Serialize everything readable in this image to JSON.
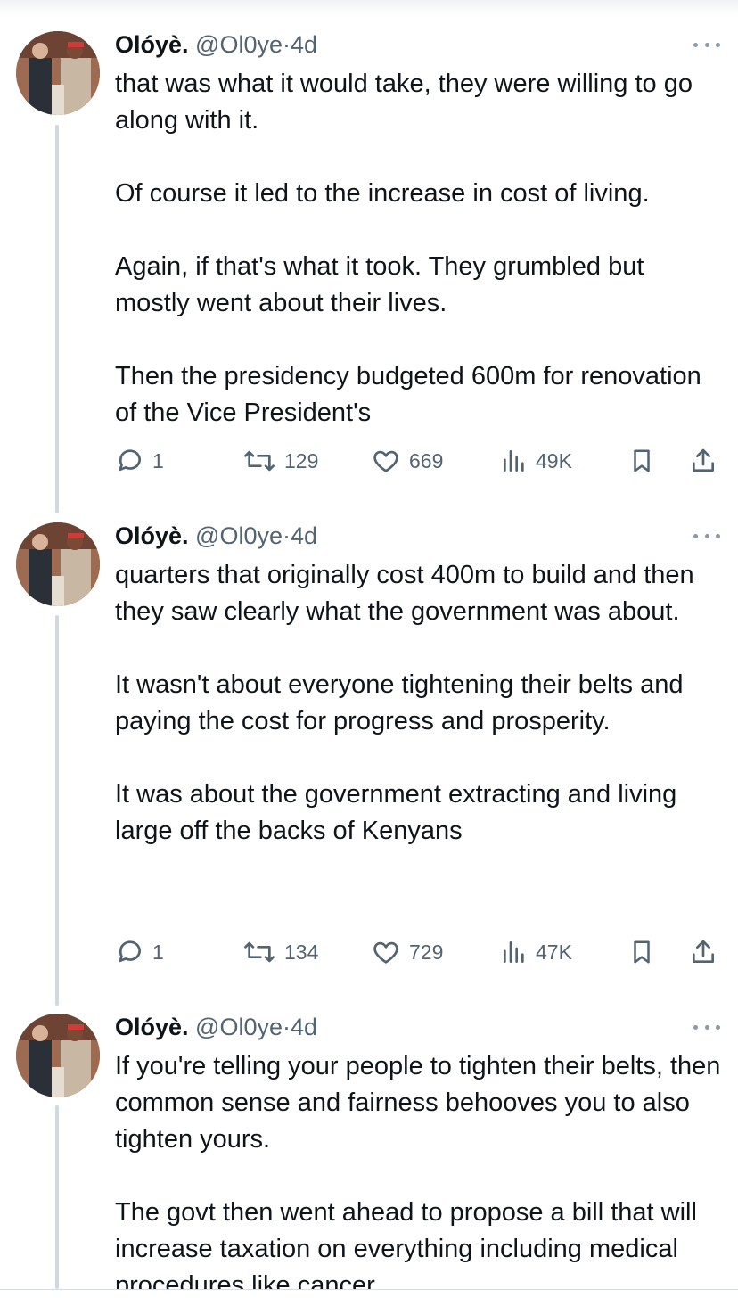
{
  "tweets": [
    {
      "author": {
        "name": "Olóyè.",
        "handle": "@Ol0ye",
        "separator": "·",
        "time": "4d"
      },
      "paragraphs": [
        "that was what it would take, they were willing to go along with it.",
        "Of course it led to the increase in cost of living.",
        "Again, if that's what it took. They grumbled but mostly went about their lives.",
        "Then the presidency budgeted 600m for renovation of the Vice President's"
      ],
      "stats": {
        "replies": "1",
        "retweets": "129",
        "likes": "669",
        "views": "49K"
      }
    },
    {
      "author": {
        "name": "Olóyè.",
        "handle": "@Ol0ye",
        "separator": "·",
        "time": "4d"
      },
      "paragraphs": [
        "quarters that originally cost 400m to build and then they saw clearly what the government was about.",
        "It wasn't about everyone tightening their belts and paying the cost for progress and prosperity.",
        "It was about the government extracting and living large off the backs of Kenyans"
      ],
      "stats": {
        "replies": "1",
        "retweets": "134",
        "likes": "729",
        "views": "47K"
      }
    },
    {
      "author": {
        "name": "Olóyè.",
        "handle": "@Ol0ye",
        "separator": "·",
        "time": "4d"
      },
      "paragraphs": [
        "If you're telling your people to tighten their belts, then common sense and fairness behooves you to also tighten yours.",
        "The govt then went ahead to propose a bill that will increase taxation on everything including medical procedures like cancer"
      ]
    }
  ],
  "icons": {
    "reply": "reply-icon",
    "retweet": "retweet-icon",
    "like": "like-icon",
    "views": "views-icon",
    "bookmark": "bookmark-icon",
    "share": "share-icon",
    "more": "more-icon"
  },
  "colors": {
    "text": "#0f1419",
    "secondary": "#536471",
    "thread_line": "#cfd9de"
  }
}
